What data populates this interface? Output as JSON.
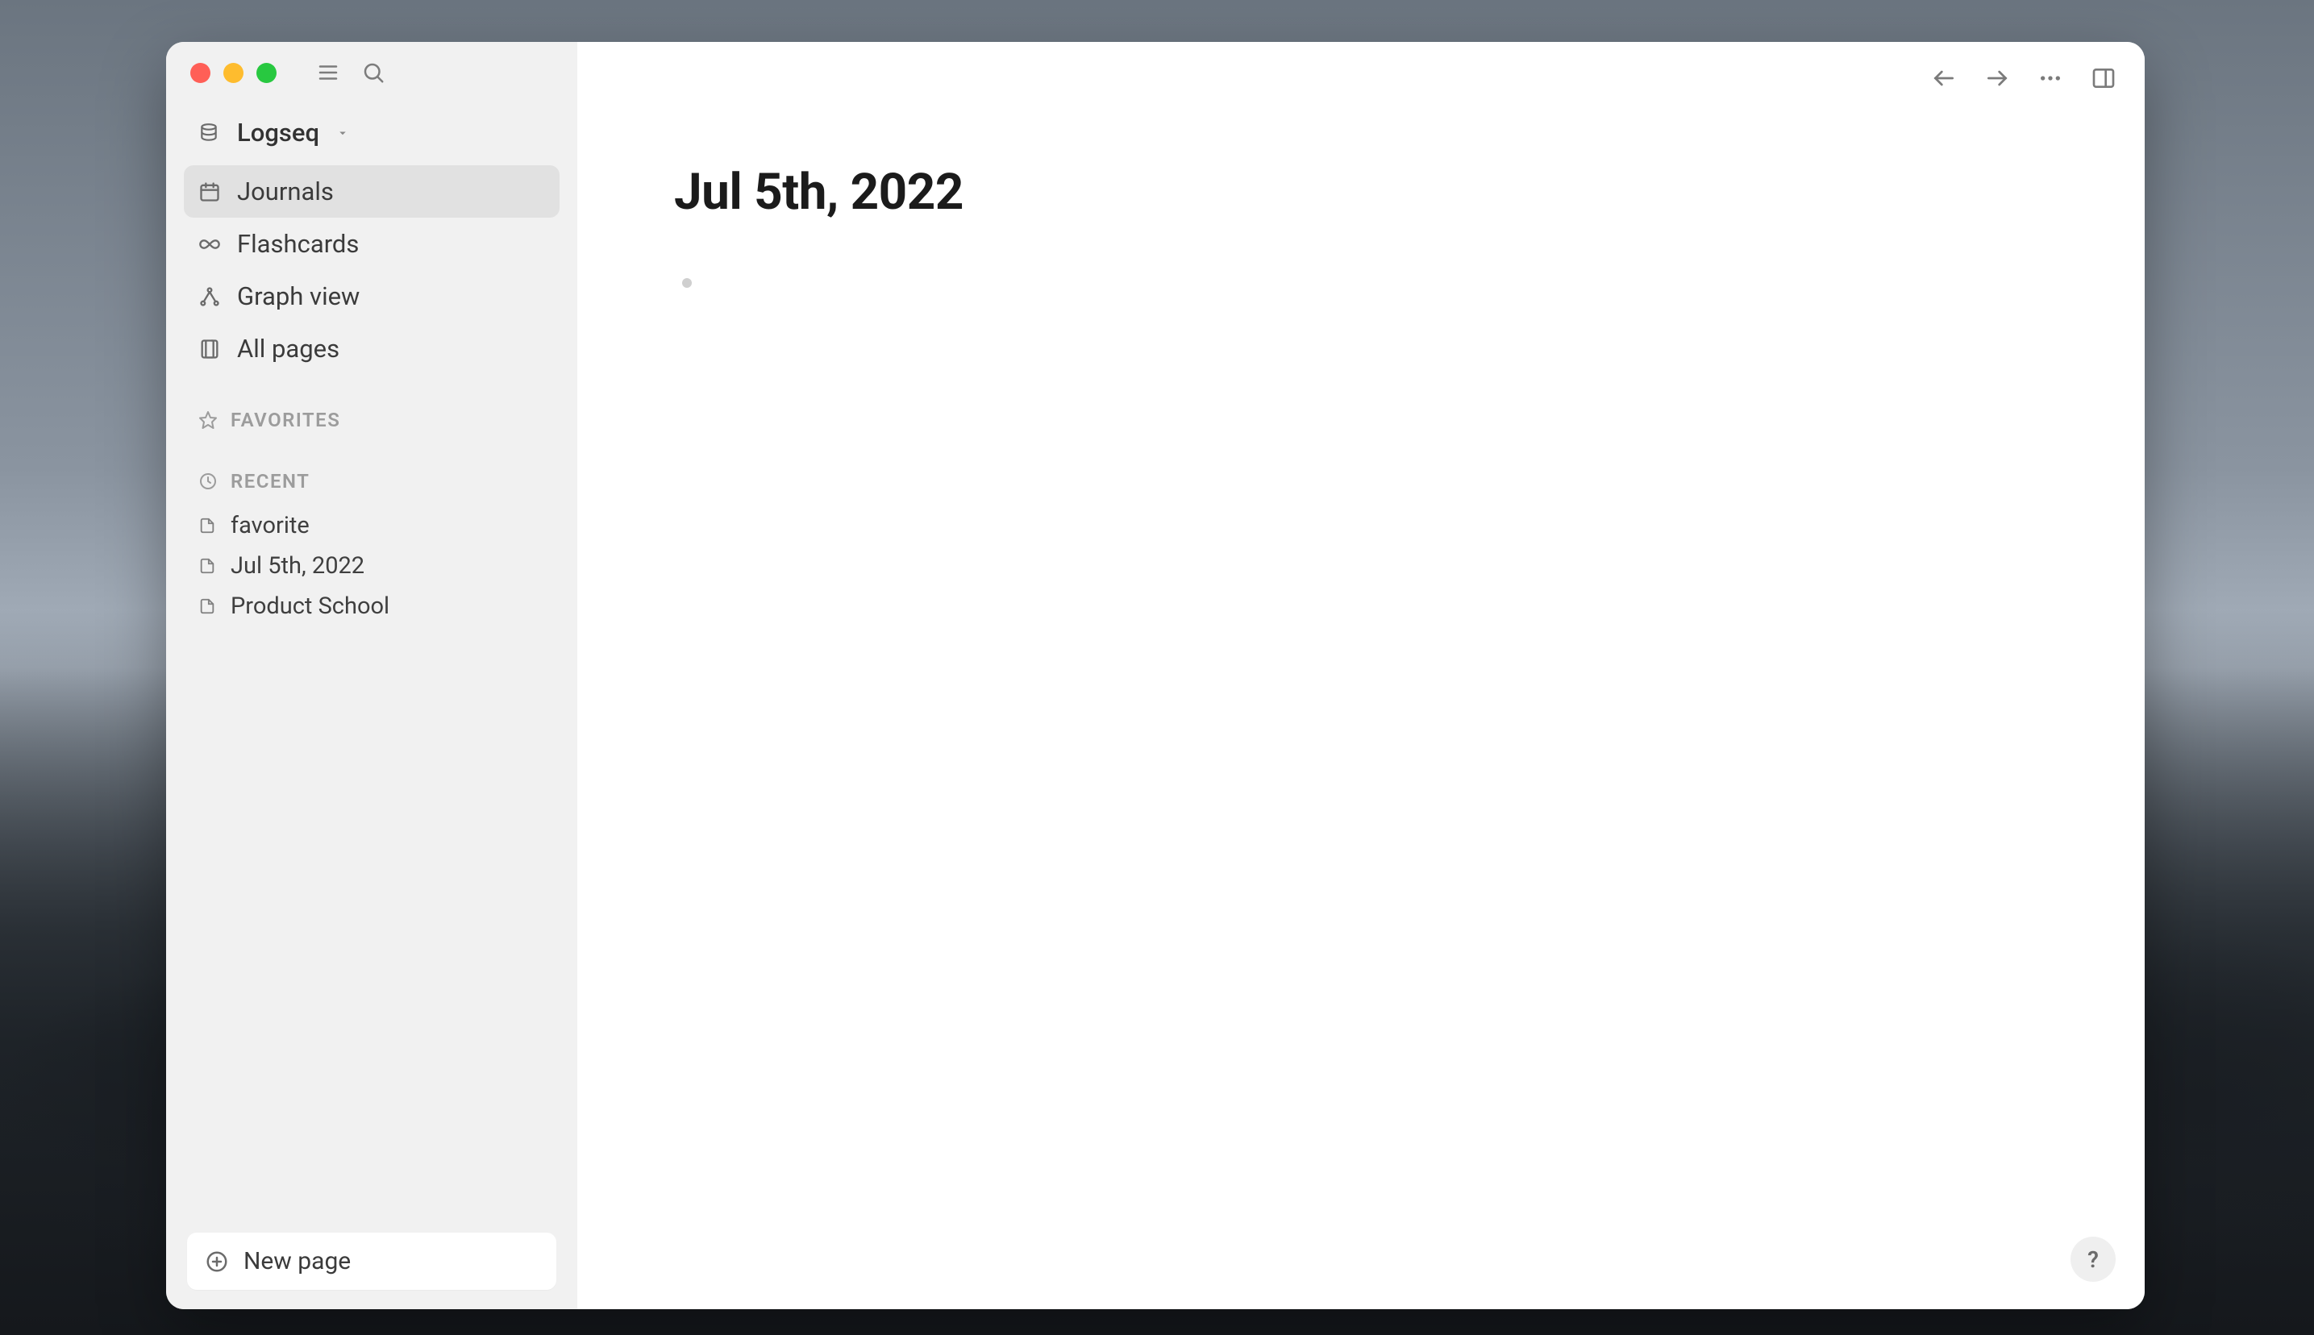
{
  "app": {
    "graph_name": "Logseq"
  },
  "sidebar": {
    "nav": [
      {
        "key": "journals",
        "label": "Journals",
        "icon": "calendar-icon",
        "active": true
      },
      {
        "key": "flashcards",
        "label": "Flashcards",
        "icon": "infinity-icon",
        "active": false
      },
      {
        "key": "graph",
        "label": "Graph view",
        "icon": "graph-icon",
        "active": false
      },
      {
        "key": "pages",
        "label": "All pages",
        "icon": "pages-icon",
        "active": false
      }
    ],
    "favorites_header": "FAVORITES",
    "recent_header": "RECENT",
    "recent": [
      {
        "label": "favorite"
      },
      {
        "label": "Jul 5th, 2022"
      },
      {
        "label": "Product School"
      }
    ],
    "new_page_label": "New page"
  },
  "main": {
    "title": "Jul 5th, 2022"
  },
  "help": {
    "label": "?"
  }
}
